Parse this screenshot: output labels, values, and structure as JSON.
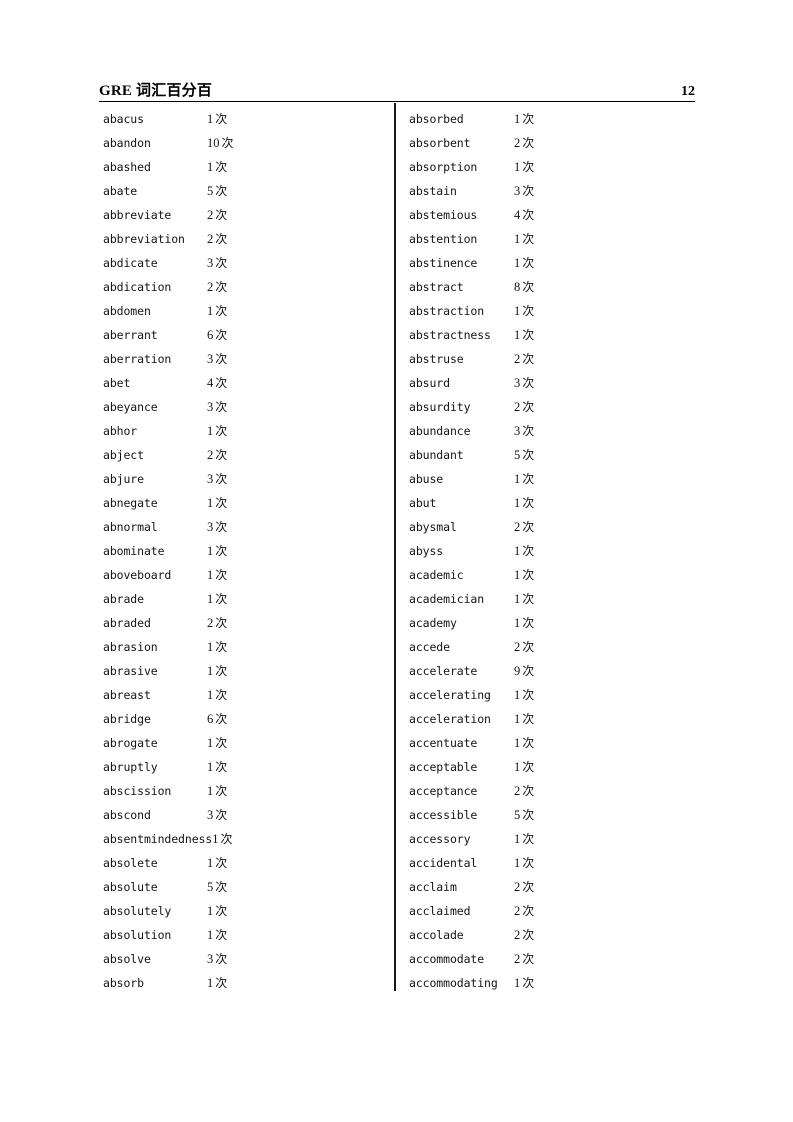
{
  "header": {
    "title": "GRE 词汇百分百",
    "page_number": "12"
  },
  "entry_unit": "次",
  "columns": {
    "left": [
      {
        "word": "abacus",
        "count": "1",
        "unit": "次"
      },
      {
        "word": "abandon",
        "count": "10",
        "unit": "次"
      },
      {
        "word": "abashed",
        "count": "1",
        "unit": "次"
      },
      {
        "word": "abate",
        "count": "5",
        "unit": "次"
      },
      {
        "word": "abbreviate",
        "count": "2",
        "unit": "次"
      },
      {
        "word": "abbreviation",
        "count": "2",
        "unit": "次"
      },
      {
        "word": "abdicate",
        "count": "3",
        "unit": "次"
      },
      {
        "word": "abdication",
        "count": "2",
        "unit": "次"
      },
      {
        "word": "abdomen",
        "count": "1",
        "unit": "次"
      },
      {
        "word": "aberrant",
        "count": "6",
        "unit": "次"
      },
      {
        "word": "aberration",
        "count": "3",
        "unit": "次"
      },
      {
        "word": "abet",
        "count": "4",
        "unit": "次"
      },
      {
        "word": "abeyance",
        "count": "3",
        "unit": "次"
      },
      {
        "word": "abhor",
        "count": "1",
        "unit": "次"
      },
      {
        "word": "abject",
        "count": "2",
        "unit": "次"
      },
      {
        "word": "abjure",
        "count": "3",
        "unit": "次"
      },
      {
        "word": "abnegate",
        "count": "1",
        "unit": "次"
      },
      {
        "word": "abnormal",
        "count": "3",
        "unit": "次"
      },
      {
        "word": "abominate",
        "count": "1",
        "unit": "次"
      },
      {
        "word": "aboveboard",
        "count": "1",
        "unit": "次"
      },
      {
        "word": "abrade",
        "count": "1",
        "unit": "次"
      },
      {
        "word": "abraded",
        "count": "2",
        "unit": "次"
      },
      {
        "word": "abrasion",
        "count": "1",
        "unit": "次"
      },
      {
        "word": "abrasive",
        "count": "1",
        "unit": "次"
      },
      {
        "word": "abreast",
        "count": "1",
        "unit": "次"
      },
      {
        "word": "abridge",
        "count": "6",
        "unit": "次"
      },
      {
        "word": "abrogate",
        "count": "1",
        "unit": "次"
      },
      {
        "word": "abruptly",
        "count": "1",
        "unit": "次"
      },
      {
        "word": "abscission",
        "count": "1",
        "unit": "次"
      },
      {
        "word": "abscond",
        "count": "3",
        "unit": "次"
      },
      {
        "word": "absentmindedness",
        "count": "1",
        "unit": "次"
      },
      {
        "word": "absolete",
        "count": "1",
        "unit": "次"
      },
      {
        "word": "absolute",
        "count": "5",
        "unit": "次"
      },
      {
        "word": "absolutely",
        "count": "1",
        "unit": "次"
      },
      {
        "word": "absolution",
        "count": "1",
        "unit": "次"
      },
      {
        "word": "absolve",
        "count": "3",
        "unit": "次"
      },
      {
        "word": "absorb",
        "count": "1",
        "unit": "次"
      }
    ],
    "right": [
      {
        "word": "absorbed",
        "count": "1",
        "unit": "次"
      },
      {
        "word": "absorbent",
        "count": "2",
        "unit": "次"
      },
      {
        "word": "absorption",
        "count": "1",
        "unit": "次"
      },
      {
        "word": "abstain",
        "count": "3",
        "unit": "次"
      },
      {
        "word": "abstemious",
        "count": "4",
        "unit": "次"
      },
      {
        "word": "abstention",
        "count": "1",
        "unit": "次"
      },
      {
        "word": "abstinence",
        "count": "1",
        "unit": "次"
      },
      {
        "word": "abstract",
        "count": "8",
        "unit": "次"
      },
      {
        "word": "abstraction",
        "count": "1",
        "unit": "次"
      },
      {
        "word": "abstractness",
        "count": "1",
        "unit": "次"
      },
      {
        "word": "abstruse",
        "count": "2",
        "unit": "次"
      },
      {
        "word": "absurd",
        "count": "3",
        "unit": "次"
      },
      {
        "word": "absurdity",
        "count": "2",
        "unit": "次"
      },
      {
        "word": "abundance",
        "count": "3",
        "unit": "次"
      },
      {
        "word": "abundant",
        "count": "5",
        "unit": "次"
      },
      {
        "word": "abuse",
        "count": "1",
        "unit": "次"
      },
      {
        "word": "abut",
        "count": "1",
        "unit": "次"
      },
      {
        "word": "abysmal",
        "count": "2",
        "unit": "次"
      },
      {
        "word": "abyss",
        "count": "1",
        "unit": "次"
      },
      {
        "word": "academic",
        "count": "1",
        "unit": "次"
      },
      {
        "word": "academician",
        "count": "1",
        "unit": "次"
      },
      {
        "word": "academy",
        "count": "1",
        "unit": "次"
      },
      {
        "word": "accede",
        "count": "2",
        "unit": "次"
      },
      {
        "word": "accelerate",
        "count": "9",
        "unit": "次"
      },
      {
        "word": "accelerating",
        "count": "1",
        "unit": "次"
      },
      {
        "word": "acceleration",
        "count": "1",
        "unit": "次"
      },
      {
        "word": "accentuate",
        "count": "1",
        "unit": "次"
      },
      {
        "word": "acceptable",
        "count": "1",
        "unit": "次"
      },
      {
        "word": "acceptance",
        "count": "2",
        "unit": "次"
      },
      {
        "word": "accessible",
        "count": "5",
        "unit": "次"
      },
      {
        "word": "accessory",
        "count": "1",
        "unit": "次"
      },
      {
        "word": "accidental",
        "count": "1",
        "unit": "次"
      },
      {
        "word": "acclaim",
        "count": "2",
        "unit": "次"
      },
      {
        "word": "acclaimed",
        "count": "2",
        "unit": "次"
      },
      {
        "word": "accolade",
        "count": "2",
        "unit": "次"
      },
      {
        "word": "accommodate",
        "count": "2",
        "unit": "次"
      },
      {
        "word": "accommodating",
        "count": "1",
        "unit": "次"
      }
    ]
  }
}
